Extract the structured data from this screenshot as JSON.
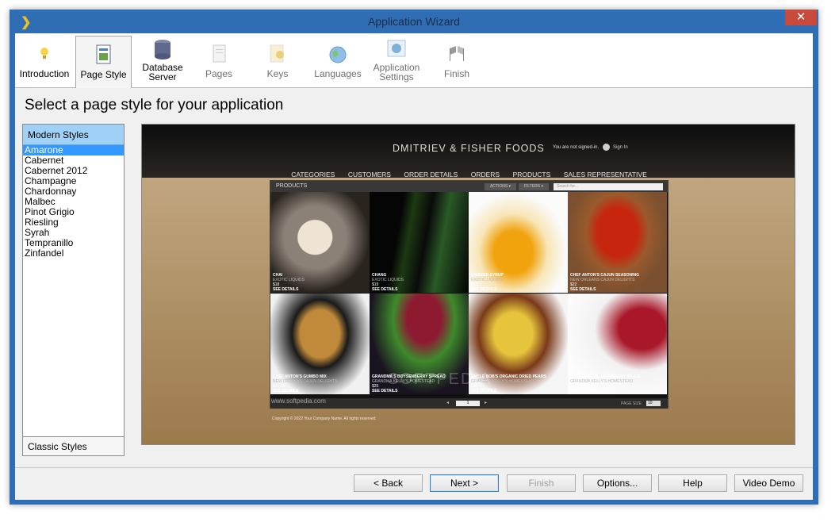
{
  "window": {
    "title": "Application Wizard",
    "close_symbol": "✕",
    "app_symbol": "❯"
  },
  "steps": [
    {
      "label": "Introduction",
      "icon": "lightbulb-icon"
    },
    {
      "label": "Page Style",
      "icon": "page-style-icon"
    },
    {
      "label": "Database Server",
      "icon": "database-icon"
    },
    {
      "label": "Pages",
      "icon": "pages-icon"
    },
    {
      "label": "Keys",
      "icon": "keys-icon"
    },
    {
      "label": "Languages",
      "icon": "globe-icon"
    },
    {
      "label": "Application Settings",
      "icon": "settings-icon"
    },
    {
      "label": "Finish",
      "icon": "checkered-flag-icon"
    }
  ],
  "heading": "Select a page style for your application",
  "styles": {
    "modern_header": "Modern Styles",
    "classic_header": "Classic Styles",
    "items": [
      "Amarone",
      "Cabernet",
      "Cabernet 2012",
      "Champagne",
      "Chardonnay",
      "Malbec",
      "Pinot Grigio",
      "Riesling",
      "Syrah",
      "Tempranillo",
      "Zinfandel"
    ],
    "selected": "Amarone"
  },
  "preview": {
    "brand": "DMITRIEV & FISHER FOODS",
    "signed_status": "You are not signed-in.",
    "sign_in": "Sign In",
    "nav": [
      "CATEGORIES",
      "CUSTOMERS",
      "ORDER DETAILS",
      "ORDERS",
      "PRODUCTS",
      "SALES REPRESENTATIVE"
    ],
    "grid_title": "PRODUCTS",
    "actions": "ACTIONS ▾",
    "filters": "FILTERS ▾",
    "search_placeholder": "Search for...",
    "see_details": "SEE DETAILS",
    "products": [
      {
        "name": "CHAI",
        "supplier": "EXOTIC LIQUIDS",
        "price": "$18"
      },
      {
        "name": "CHANG",
        "supplier": "EXOTIC LIQUIDS",
        "price": "$19"
      },
      {
        "name": "ANISEED SYRUP",
        "supplier": "EXOTIC LIQUIDS",
        "price": "$10"
      },
      {
        "name": "CHEF ANTON'S CAJUN SEASONING",
        "supplier": "NEW ORLEANS CAJUN DELIGHTS",
        "price": "$22"
      },
      {
        "name": "CHEF ANTON'S GUMBO MIX",
        "supplier": "NEW ORLEANS CAJUN DELIGHTS",
        "price": "$21.35"
      },
      {
        "name": "GRANDMA'S BOYSENBERRY SPREAD",
        "supplier": "GRANDMA KELLY'S HOMESTEAD",
        "price": "$25"
      },
      {
        "name": "UNCLE BOB'S ORGANIC DRIED PEARS",
        "supplier": "GRANDMA KELLY'S HOMESTEAD",
        "price": "$30"
      },
      {
        "name": "NORTHWOODS CRANBERRY SAUCE",
        "supplier": "GRANDMA KELLY'S HOMESTEAD",
        "price": "$40"
      }
    ],
    "pager_value": "1",
    "page_size_label": "PAGE SIZE",
    "page_size_value": "10",
    "copyright": "Copyright © 2022 Your Company Name. All rights reserved.",
    "watermark": "www.softpedia.com",
    "watermark_big": "SOFTPEDIA"
  },
  "buttons": {
    "back": "< Back",
    "next": "Next >",
    "finish": "Finish",
    "options": "Options...",
    "help": "Help",
    "video": "Video Demo"
  }
}
